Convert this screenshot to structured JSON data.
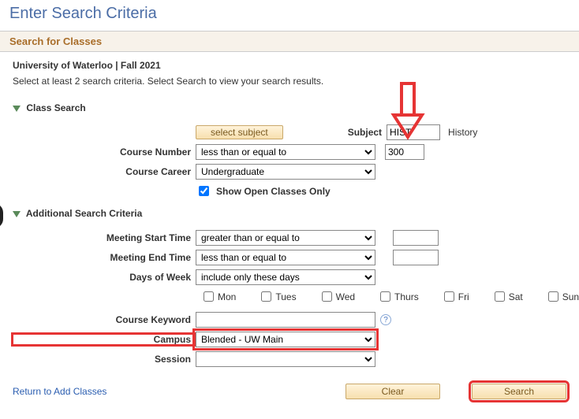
{
  "page_title": "Enter Search Criteria",
  "section_title": "Search for Classes",
  "context": "University of Waterloo | Fall 2021",
  "instruction": "Select at least 2 search criteria. Select Search to view your search results.",
  "class_search": {
    "header": "Class Search",
    "select_subject_btn": "select subject",
    "subject_label": "Subject",
    "subject_value": "HIST",
    "subject_desc": "History",
    "course_number_label": "Course Number",
    "course_number_op": "less than or equal to",
    "course_number_val": "300",
    "course_career_label": "Course Career",
    "course_career_val": "Undergraduate",
    "open_only_label": "Show Open Classes Only",
    "open_only_checked": true
  },
  "additional": {
    "header": "Additional Search Criteria",
    "start_label": "Meeting Start Time",
    "start_op": "greater than or equal to",
    "start_val": "",
    "end_label": "Meeting End Time",
    "end_op": "less than or equal to",
    "end_val": "",
    "days_label": "Days of Week",
    "days_op": "include only these days",
    "days": {
      "mon": "Mon",
      "tues": "Tues",
      "wed": "Wed",
      "thurs": "Thurs",
      "fri": "Fri",
      "sat": "Sat",
      "sun": "Sun"
    },
    "keyword_label": "Course Keyword",
    "keyword_val": "",
    "campus_label": "Campus",
    "campus_val": "Blended - UW Main",
    "session_label": "Session",
    "session_val": ""
  },
  "footer": {
    "return_link": "Return to Add Classes",
    "clear_btn": "Clear",
    "search_btn": "Search"
  }
}
